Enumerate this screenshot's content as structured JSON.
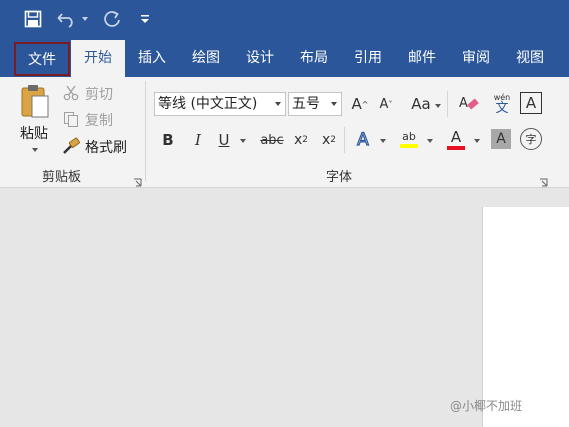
{
  "qat": {
    "save_icon": "save-icon",
    "undo_icon": "undo-icon",
    "redo_icon": "redo-icon",
    "customize_icon": "customize-qat-icon"
  },
  "tabs": [
    {
      "label": "文件"
    },
    {
      "label": "开始"
    },
    {
      "label": "插入"
    },
    {
      "label": "绘图"
    },
    {
      "label": "设计"
    },
    {
      "label": "布局"
    },
    {
      "label": "引用"
    },
    {
      "label": "邮件"
    },
    {
      "label": "审阅"
    },
    {
      "label": "视图"
    }
  ],
  "clipboard": {
    "paste_label": "粘贴",
    "cut_label": "剪切",
    "copy_label": "复制",
    "format_painter_label": "格式刷",
    "group_label": "剪贴板"
  },
  "font": {
    "font_name": "等线 (中文正文)",
    "font_size": "五号",
    "grow_label": "A",
    "shrink_label": "A",
    "case_label": "Aa",
    "bold_label": "B",
    "italic_label": "I",
    "underline_label": "U",
    "strike_label": "abc",
    "sub_label": "x",
    "sub_suffix": "2",
    "sup_label": "x",
    "sup_suffix": "2",
    "effects_label": "A",
    "highlight_label": "ab",
    "fontcolor_label": "A",
    "charshade_label": "A",
    "enclose_label": "字",
    "phonetic_top": "wén",
    "phonetic_bottom": "文",
    "border_label": "A",
    "group_label": "字体"
  },
  "colors": {
    "brand": "#2b579a",
    "file_outline": "#7b1c24",
    "highlight": "#ffff00",
    "font_color": "#e81123"
  },
  "watermark": "@小椰不加班"
}
